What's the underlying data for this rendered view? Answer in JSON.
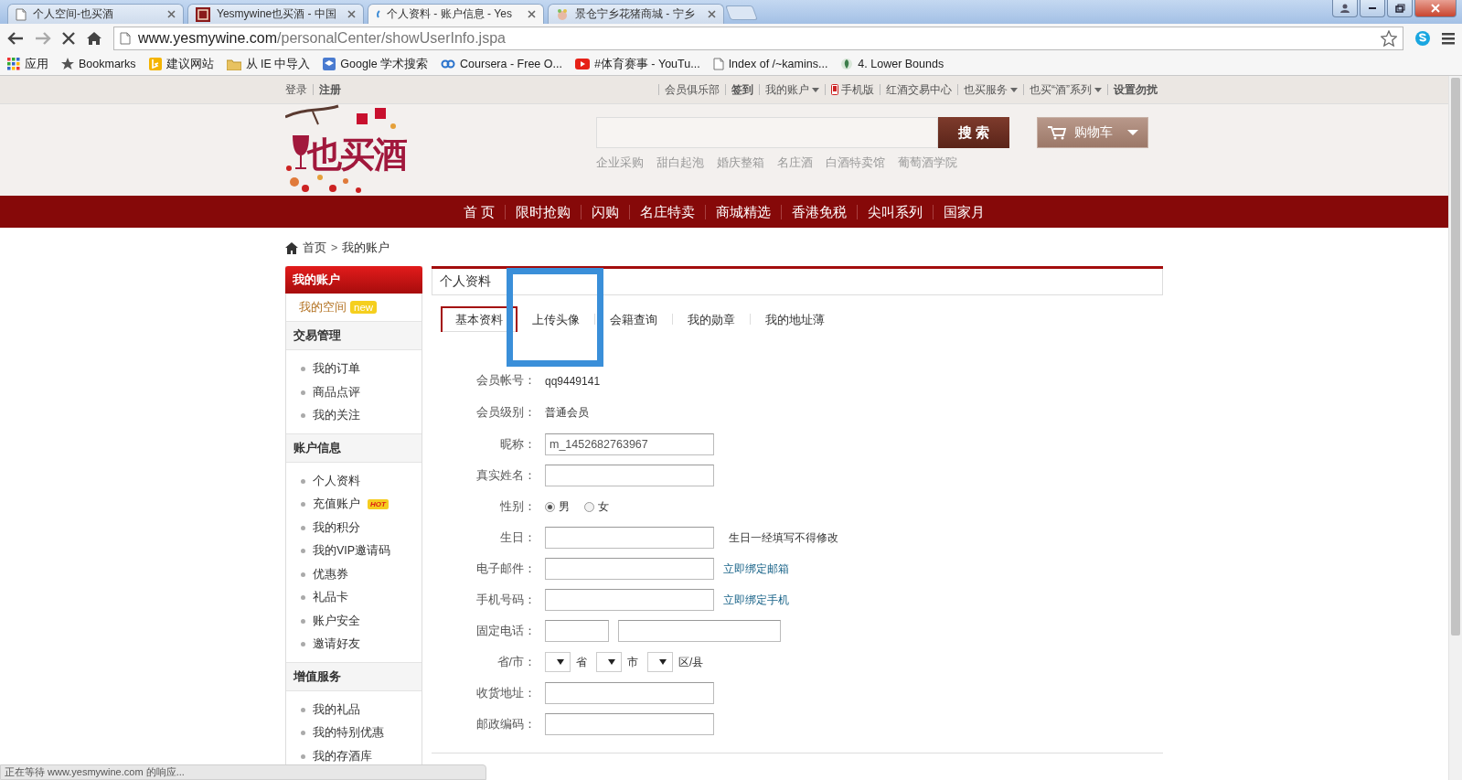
{
  "browser": {
    "tabs": [
      {
        "title": "个人空间-也买酒",
        "selected": false
      },
      {
        "title": "Yesmywine也买酒 - 中国",
        "selected": false
      },
      {
        "title": "个人资料 - 账户信息 - Yes",
        "selected": true
      },
      {
        "title": "景仓宁乡花猪商城 - 宁乡",
        "selected": false
      }
    ],
    "url_host": "www.yesmywine.com",
    "url_path": "/personalCenter/showUserInfo.jspa",
    "bookmarks": [
      {
        "label": "应用"
      },
      {
        "label": "Bookmarks"
      },
      {
        "label": "建议网站"
      },
      {
        "label": "从 IE 中导入"
      },
      {
        "label": "Google 学术搜索"
      },
      {
        "label": "Coursera - Free O..."
      },
      {
        "label": "#体育赛事 - YouTu..."
      },
      {
        "label": "Index of /~kamins..."
      },
      {
        "label": "4. Lower Bounds"
      }
    ],
    "status": "正在等待 www.yesmywine.com 的响应..."
  },
  "site": {
    "top_left": [
      {
        "label": "登录",
        "bold": false
      },
      {
        "label": "注册",
        "bold": true
      }
    ],
    "top_right": [
      {
        "label": "会员俱乐部",
        "bold": false,
        "dropdown": false,
        "phone_icon": false
      },
      {
        "label": "签到",
        "bold": true,
        "dropdown": false,
        "phone_icon": false
      },
      {
        "label": "我的账户",
        "bold": false,
        "dropdown": true,
        "phone_icon": false
      },
      {
        "label": "手机版",
        "bold": false,
        "dropdown": false,
        "phone_icon": true
      },
      {
        "label": "红酒交易中心",
        "bold": false,
        "dropdown": false,
        "phone_icon": false
      },
      {
        "label": "也买服务",
        "bold": false,
        "dropdown": true,
        "phone_icon": false
      },
      {
        "label": "也买“酒”系列",
        "bold": false,
        "dropdown": true,
        "phone_icon": false
      },
      {
        "label": "设置勿扰",
        "bold": true,
        "dropdown": false,
        "phone_icon": false
      }
    ],
    "logo": "也买酒",
    "search_button": "搜 索",
    "hot_searches": [
      "企业采购",
      "甜白起泡",
      "婚庆整箱",
      "名庄酒",
      "白酒特卖馆",
      "葡萄酒学院"
    ],
    "cart": "购物车",
    "nav": [
      "首 页",
      "限时抢购",
      "闪购",
      "名庄特卖",
      "商城精选",
      "香港免税",
      "尖叫系列",
      "国家月"
    ]
  },
  "breadcrumb": [
    "首页",
    "我的账户"
  ],
  "breadcrumb_separator": ">",
  "sidebar": {
    "title": "我的账户",
    "space": {
      "label": "我的空间",
      "badge": "new"
    },
    "groups": [
      {
        "title": "交易管理",
        "items": [
          {
            "label": "我的订单"
          },
          {
            "label": "商品点评"
          },
          {
            "label": "我的关注"
          }
        ]
      },
      {
        "title": "账户信息",
        "items": [
          {
            "label": "个人资料"
          },
          {
            "label": "充值账户",
            "badge": "HOT"
          },
          {
            "label": "我的积分"
          },
          {
            "label": "我的VIP邀请码"
          },
          {
            "label": "优惠券"
          },
          {
            "label": "礼品卡"
          },
          {
            "label": "账户安全"
          },
          {
            "label": "邀请好友"
          }
        ]
      },
      {
        "title": "增值服务",
        "items": [
          {
            "label": "我的礼品"
          },
          {
            "label": "我的特别优惠"
          },
          {
            "label": "我的存酒库"
          }
        ]
      }
    ]
  },
  "panel": {
    "title": "个人资料",
    "tabs": [
      {
        "label": "基本资料",
        "selected": true,
        "highlighted": false
      },
      {
        "label": "上传头像",
        "selected": false,
        "highlighted": true
      },
      {
        "label": "会籍查询",
        "selected": false,
        "highlighted": false
      },
      {
        "label": "我的勋章",
        "selected": false,
        "highlighted": false
      },
      {
        "label": "我的地址薄",
        "selected": false,
        "highlighted": false
      }
    ],
    "fields": [
      {
        "kind": "text",
        "label": "会员帐号：",
        "value": "qq9449141"
      },
      {
        "kind": "text",
        "label": "会员级别：",
        "value": "普通会员"
      },
      {
        "kind": "input",
        "label": "昵称：",
        "value": "m_1452682763967"
      },
      {
        "kind": "input",
        "label": "真实姓名："
      },
      {
        "kind": "radio",
        "label": "性别：",
        "options": [
          {
            "label": "男",
            "selected": true
          },
          {
            "label": "女",
            "selected": false
          }
        ]
      },
      {
        "kind": "input",
        "label": "生日：",
        "note": "生日一经填写不得修改"
      },
      {
        "kind": "input",
        "label": "电子邮件：",
        "link": "立即绑定邮箱"
      },
      {
        "kind": "input",
        "label": "手机号码：",
        "link": "立即绑定手机"
      },
      {
        "kind": "phone",
        "label": "固定电话："
      },
      {
        "kind": "region",
        "label": "省/市：",
        "parts": [
          "省",
          "市",
          "区/县"
        ]
      },
      {
        "kind": "input",
        "label": "收货地址："
      },
      {
        "kind": "input",
        "label": "邮政编码："
      }
    ]
  }
}
